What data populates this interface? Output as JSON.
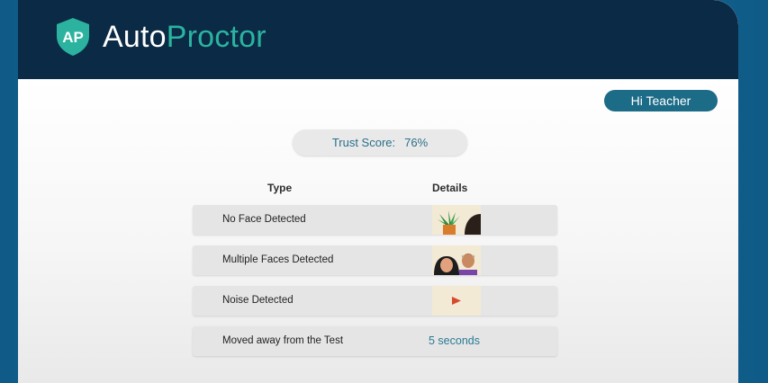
{
  "app": {
    "logo_mark": "AP",
    "name_part1": "Auto",
    "name_part2": "Proctor"
  },
  "user_button": {
    "label": "Hi Teacher"
  },
  "trust_score": {
    "label": "Trust Score:",
    "value": "76%"
  },
  "table": {
    "headers": {
      "type": "Type",
      "details": "Details"
    },
    "rows": [
      {
        "type": "No Face Detected",
        "detail_kind": "image",
        "icon": "plant-and-partial-head-thumbnail"
      },
      {
        "type": "Multiple Faces Detected",
        "detail_kind": "image",
        "icon": "two-faces-thumbnail"
      },
      {
        "type": "Noise Detected",
        "detail_kind": "image",
        "icon": "play-audio-thumbnail"
      },
      {
        "type": "Moved away from the Test",
        "detail_kind": "text",
        "detail": "5 seconds"
      }
    ]
  },
  "colors": {
    "header_bg": "#0b2a45",
    "brand_teal": "#2bb3a0",
    "button_bg": "#1c6b87",
    "accent_text": "#2a7a94"
  }
}
